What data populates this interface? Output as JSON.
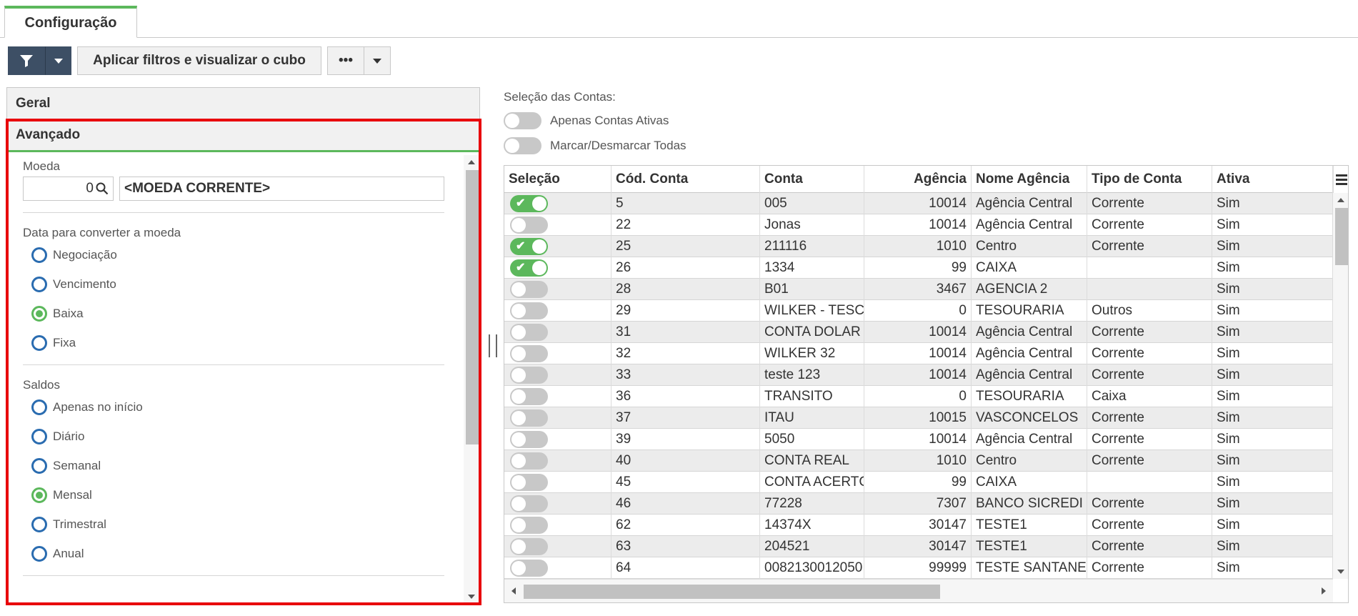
{
  "tabs": {
    "active": "Configuração"
  },
  "toolbar": {
    "apply_label": "Aplicar filtros e visualizar o cubo",
    "more_label": "•••"
  },
  "accordion": {
    "geral": "Geral",
    "avancado": "Avançado"
  },
  "moeda": {
    "label": "Moeda",
    "code": "0",
    "description": "<MOEDA CORRENTE>"
  },
  "data_conversao": {
    "label": "Data para converter a moeda",
    "options": [
      {
        "label": "Negociação",
        "checked": false
      },
      {
        "label": "Vencimento",
        "checked": false
      },
      {
        "label": "Baixa",
        "checked": true
      },
      {
        "label": "Fixa",
        "checked": false
      }
    ]
  },
  "saldos": {
    "label": "Saldos",
    "options": [
      {
        "label": "Apenas no início",
        "checked": false
      },
      {
        "label": "Diário",
        "checked": false
      },
      {
        "label": "Semanal",
        "checked": false
      },
      {
        "label": "Mensal",
        "checked": true
      },
      {
        "label": "Trimestral",
        "checked": false
      },
      {
        "label": "Anual",
        "checked": false
      }
    ]
  },
  "selecao": {
    "title": "Seleção das Contas:",
    "apenas_ativas": "Apenas Contas Ativas",
    "marcar_todas": "Marcar/Desmarcar Todas"
  },
  "grid": {
    "headers": [
      "Seleção",
      "Cód. Conta",
      "Conta",
      "Agência",
      "Nome Agência",
      "Tipo de Conta",
      "Ativa"
    ],
    "rows": [
      {
        "sel": true,
        "cod": "5",
        "conta": "005",
        "agencia": "10014",
        "nome": "Agência Central",
        "tipo": "Corrente",
        "ativa": "Sim"
      },
      {
        "sel": false,
        "cod": "22",
        "conta": "Jonas",
        "agencia": "10014",
        "nome": "Agência Central",
        "tipo": "Corrente",
        "ativa": "Sim"
      },
      {
        "sel": true,
        "cod": "25",
        "conta": "211116",
        "agencia": "1010",
        "nome": "Centro",
        "tipo": "Corrente",
        "ativa": "Sim"
      },
      {
        "sel": true,
        "cod": "26",
        "conta": "1334",
        "agencia": "99",
        "nome": "CAIXA",
        "tipo": "",
        "ativa": "Sim"
      },
      {
        "sel": false,
        "cod": "28",
        "conta": "B01",
        "agencia": "3467",
        "nome": "AGENCIA 2",
        "tipo": "",
        "ativa": "Sim"
      },
      {
        "sel": false,
        "cod": "29",
        "conta": "WILKER - TESC",
        "agencia": "0",
        "nome": "TESOURARIA",
        "tipo": "Outros",
        "ativa": "Sim"
      },
      {
        "sel": false,
        "cod": "31",
        "conta": "CONTA DOLAR",
        "agencia": "10014",
        "nome": "Agência Central",
        "tipo": "Corrente",
        "ativa": "Sim"
      },
      {
        "sel": false,
        "cod": "32",
        "conta": "WILKER 32",
        "agencia": "10014",
        "nome": "Agência Central",
        "tipo": "Corrente",
        "ativa": "Sim"
      },
      {
        "sel": false,
        "cod": "33",
        "conta": "teste 123",
        "agencia": "10014",
        "nome": "Agência Central",
        "tipo": "Corrente",
        "ativa": "Sim"
      },
      {
        "sel": false,
        "cod": "36",
        "conta": "TRANSITO",
        "agencia": "0",
        "nome": "TESOURARIA",
        "tipo": "Caixa",
        "ativa": "Sim"
      },
      {
        "sel": false,
        "cod": "37",
        "conta": "ITAU",
        "agencia": "10015",
        "nome": "VASCONCELOS",
        "tipo": "Corrente",
        "ativa": "Sim"
      },
      {
        "sel": false,
        "cod": "39",
        "conta": "5050",
        "agencia": "10014",
        "nome": "Agência Central",
        "tipo": "Corrente",
        "ativa": "Sim"
      },
      {
        "sel": false,
        "cod": "40",
        "conta": "CONTA REAL",
        "agencia": "1010",
        "nome": "Centro",
        "tipo": "Corrente",
        "ativa": "Sim"
      },
      {
        "sel": false,
        "cod": "45",
        "conta": "CONTA ACERTC",
        "agencia": "99",
        "nome": "CAIXA",
        "tipo": "",
        "ativa": "Sim"
      },
      {
        "sel": false,
        "cod": "46",
        "conta": "77228",
        "agencia": "7307",
        "nome": "BANCO SICREDI",
        "tipo": "Corrente",
        "ativa": "Sim"
      },
      {
        "sel": false,
        "cod": "62",
        "conta": "14374X",
        "agencia": "30147",
        "nome": "TESTE1",
        "tipo": "Corrente",
        "ativa": "Sim"
      },
      {
        "sel": false,
        "cod": "63",
        "conta": "204521",
        "agencia": "30147",
        "nome": "TESTE1",
        "tipo": "Corrente",
        "ativa": "Sim"
      },
      {
        "sel": false,
        "cod": "64",
        "conta": "0082130012050",
        "agencia": "99999",
        "nome": "TESTE SANTANE",
        "tipo": "Corrente",
        "ativa": "Sim"
      }
    ]
  },
  "colors": {
    "accent": "#5cb85c",
    "dark": "#3d4f65",
    "highlight": "#e8000b"
  }
}
